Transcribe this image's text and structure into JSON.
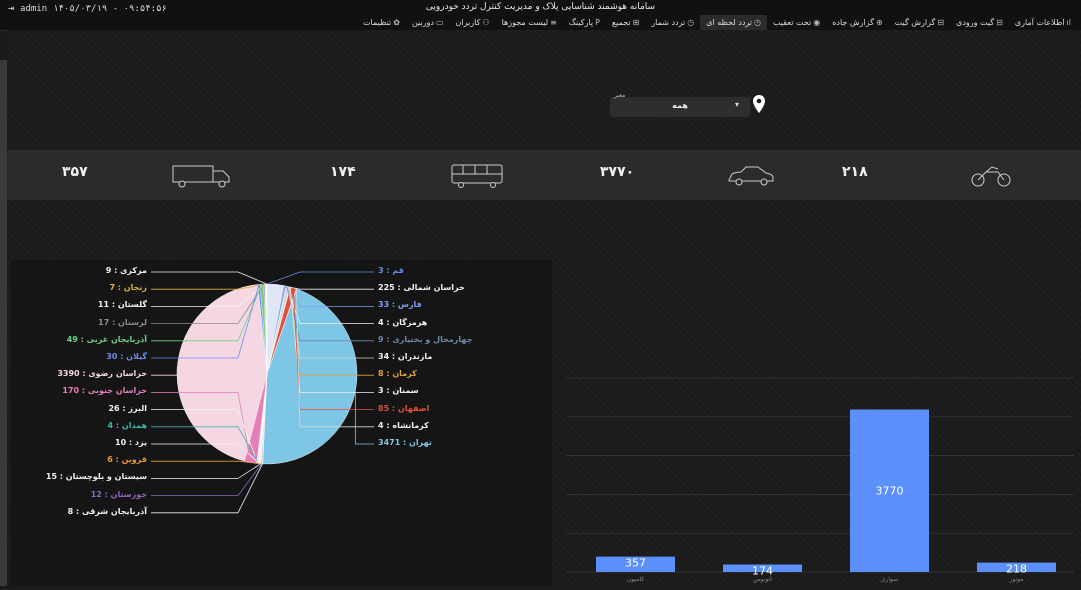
{
  "header": {
    "title": "سامانه هوشمند شناسایی پلاک و مدیریت کنترل تردد خودرویی",
    "user": "admin",
    "datetime": "۱۴۰۵/۰۳/۱۹ - ۰۹:۵۴:۵۶",
    "logout_icon": "logout-icon"
  },
  "nav": {
    "items": [
      {
        "label": "اطلاعات آماری",
        "icon": "chart-icon",
        "glyph": "ıl",
        "active": false
      },
      {
        "label": "گیت ورودی",
        "icon": "gate-icon",
        "glyph": "⊟",
        "active": false
      },
      {
        "label": "گزارش گیت",
        "icon": "report-icon",
        "glyph": "⊟",
        "active": false
      },
      {
        "label": "گزارش جاده",
        "icon": "road-icon",
        "glyph": "⊕",
        "active": false
      },
      {
        "label": "تحت تعقیب",
        "icon": "alert-icon",
        "glyph": "◉",
        "active": false
      },
      {
        "label": "تردد لحظه ای",
        "icon": "clock-icon",
        "glyph": "◷",
        "active": true
      },
      {
        "label": "تردد شمار",
        "icon": "counter-icon",
        "glyph": "◷",
        "active": false
      },
      {
        "label": "تجمیع",
        "icon": "grid-icon",
        "glyph": "⊞",
        "active": false
      },
      {
        "label": "پارکینگ",
        "icon": "parking-icon",
        "glyph": "P",
        "active": false
      },
      {
        "label": "لیست مجوزها",
        "icon": "list-icon",
        "glyph": "≡",
        "active": false
      },
      {
        "label": "کاربران",
        "icon": "users-icon",
        "glyph": "⚇",
        "active": false
      },
      {
        "label": "دوربین",
        "icon": "camera-icon",
        "glyph": "▭",
        "active": false
      },
      {
        "label": "تنظیمات",
        "icon": "gear-icon",
        "glyph": "✿",
        "active": false
      }
    ]
  },
  "filter": {
    "label": "معبر",
    "value": "همه",
    "icon": "location-pin-icon"
  },
  "stats": [
    {
      "value": "۳۵۷",
      "icon": "truck-icon"
    },
    {
      "value": "۱۷۴",
      "icon": "bus-icon"
    },
    {
      "value": "۳۷۷۰",
      "icon": "car-icon"
    },
    {
      "value": "۲۱۸",
      "icon": "motorcycle-icon"
    }
  ],
  "chart_data": [
    {
      "type": "pie",
      "slices": [
        {
          "label": "قم",
          "value": 3,
          "color": "#6b8df0",
          "side": "right"
        },
        {
          "label": "خراسان شمالی",
          "value": 225,
          "color": "#dfe7f7",
          "side": "right"
        },
        {
          "label": "فارس",
          "value": 33,
          "color": "#7d9ff2",
          "side": "right"
        },
        {
          "label": "هرمزگان",
          "value": 4,
          "color": "#f1f1f1",
          "side": "right"
        },
        {
          "label": "چهارمحال و بختیاری",
          "value": 9,
          "color": "#6f89a8",
          "side": "right"
        },
        {
          "label": "مازندران",
          "value": 34,
          "color": "#cfcfcf",
          "side": "right"
        },
        {
          "label": "کرمان",
          "value": 8,
          "color": "#e0a43c",
          "side": "right"
        },
        {
          "label": "سمنان",
          "value": 3,
          "color": "#efefef",
          "side": "right"
        },
        {
          "label": "اصفهان",
          "value": 85,
          "color": "#e0503c",
          "side": "right"
        },
        {
          "label": "کرمانشاه",
          "value": 4,
          "color": "#d8d8d8",
          "side": "right"
        },
        {
          "label": "تهران",
          "value": 3471,
          "color": "#7ec6e6",
          "side": "right"
        },
        {
          "label": "آذربایجان شرقی",
          "value": 8,
          "color": "#f1f1f1",
          "side": "left"
        },
        {
          "label": "خوزستان",
          "value": 12,
          "color": "#8a6ab8",
          "side": "left"
        },
        {
          "label": "سیستان و بلوچستان",
          "value": 15,
          "color": "#f1f1f1",
          "side": "left"
        },
        {
          "label": "قزوین",
          "value": 6,
          "color": "#e89a3a",
          "side": "left"
        },
        {
          "label": "یزد",
          "value": 10,
          "color": "#f1f1f1",
          "side": "left"
        },
        {
          "label": "همدان",
          "value": 4,
          "color": "#44b3a8",
          "side": "left"
        },
        {
          "label": "البرز",
          "value": 26,
          "color": "#f1f1f1",
          "side": "left"
        },
        {
          "label": "خراسان جنوبی",
          "value": 170,
          "color": "#e47fb8",
          "side": "left"
        },
        {
          "label": "خراسان رضوی",
          "value": 3390,
          "color": "#f4d7e3",
          "side": "left"
        },
        {
          "label": "گیلان",
          "value": 30,
          "color": "#6b8df0",
          "side": "left"
        },
        {
          "label": "آذربایجان غربی",
          "value": 49,
          "color": "#6fcf85",
          "side": "left"
        },
        {
          "label": "لرستان",
          "value": 17,
          "color": "#8c8c8c",
          "side": "left"
        },
        {
          "label": "گلستان",
          "value": 11,
          "color": "#f1f1f1",
          "side": "left"
        },
        {
          "label": "زنجان",
          "value": 7,
          "color": "#e0b040",
          "side": "left"
        },
        {
          "label": "مرکزی",
          "value": 9,
          "color": "#f1f1f1",
          "side": "left"
        }
      ]
    },
    {
      "type": "bar",
      "categories": [
        "کامیون",
        "اتوبوس",
        "سواری",
        "موتور"
      ],
      "values": [
        357,
        174,
        3770,
        218
      ],
      "ylim": [
        0,
        4500
      ],
      "grid": true,
      "color": "#5b8ff9"
    }
  ]
}
